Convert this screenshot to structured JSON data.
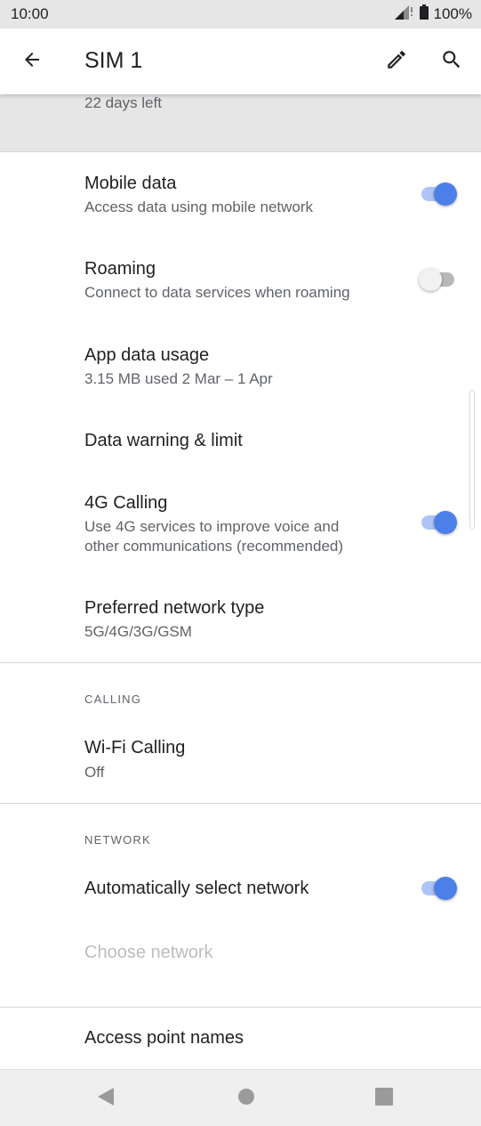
{
  "status_bar": {
    "time": "10:00",
    "battery": "100%"
  },
  "app_bar": {
    "title": "SIM 1"
  },
  "usage_header": {
    "days_left": "22 days left"
  },
  "rows": [
    {
      "title": "Mobile data",
      "summary": "Access data using mobile network",
      "toggle": "on"
    },
    {
      "title": "Roaming",
      "summary": "Connect to data services when roaming",
      "toggle": "off"
    },
    {
      "title": "App data usage",
      "summary": "3.15 MB used 2 Mar – 1 Apr"
    },
    {
      "title": "Data warning & limit"
    },
    {
      "title": "4G Calling",
      "summary_line1": "Use 4G services to improve voice and",
      "summary_line2": "other communications (recommended)",
      "toggle": "on"
    },
    {
      "title": "Preferred network type",
      "summary": "5G/4G/3G/GSM"
    }
  ],
  "calling_section": {
    "header": "CALLING",
    "wifi_calling": {
      "title": "Wi-Fi Calling",
      "summary": "Off"
    }
  },
  "network_section": {
    "header": "NETWORK",
    "auto_select": {
      "title": "Automatically select network",
      "toggle": "on"
    },
    "choose_network": {
      "title": "Choose network",
      "enabled": false
    }
  },
  "access_point_names": {
    "title": "Access point names"
  },
  "colors": {
    "accent": "#4c7fe8",
    "accent_track": "#aec4f7",
    "header_bg": "#e6e6e6"
  },
  "icons": [
    "signal-icon",
    "battery-icon",
    "back-arrow-icon",
    "edit-pencil-icon",
    "search-icon",
    "nav-back-icon",
    "nav-home-icon",
    "nav-recents-icon"
  ]
}
